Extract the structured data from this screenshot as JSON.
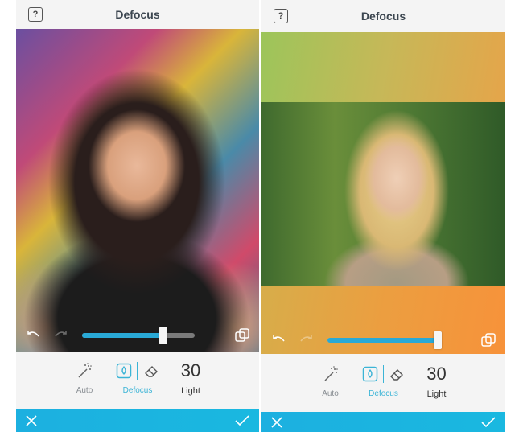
{
  "screens": [
    {
      "header": {
        "title": "Defocus",
        "help_icon": "help-icon"
      },
      "photo": {
        "description": "Portrait of smiling woman with dark hair against colorful graffiti wall (blurred background)"
      },
      "controls": {
        "undo_icon": "undo-icon",
        "redo_icon": "redo-icon",
        "compare_icon": "compare-icon",
        "slider_value_fraction": 0.72
      },
      "toolbar": {
        "auto_label": "Auto",
        "defocus_label": "Defocus",
        "value": "30",
        "value_label": "Light"
      },
      "bottom_bar": {
        "cancel_icon": "close-icon",
        "apply_icon": "checkmark-icon"
      }
    },
    {
      "header": {
        "title": "Defocus",
        "help_icon": "help-icon"
      },
      "photo": {
        "description": "Portrait of blonde woman against green foliage, with green-to-orange gradient bands above and below"
      },
      "controls": {
        "undo_icon": "undo-icon",
        "redo_icon": "redo-icon",
        "compare_icon": "compare-icon",
        "slider_value_fraction": 0.98
      },
      "toolbar": {
        "auto_label": "Auto",
        "defocus_label": "Defocus",
        "value": "30",
        "value_label": "Light"
      },
      "bottom_bar": {
        "cancel_icon": "close-icon",
        "apply_icon": "checkmark-icon"
      }
    }
  ],
  "colors": {
    "accent": "#29a9d6",
    "bottom_bar": "#1cb0e0",
    "active_label": "#3bb4d6"
  }
}
